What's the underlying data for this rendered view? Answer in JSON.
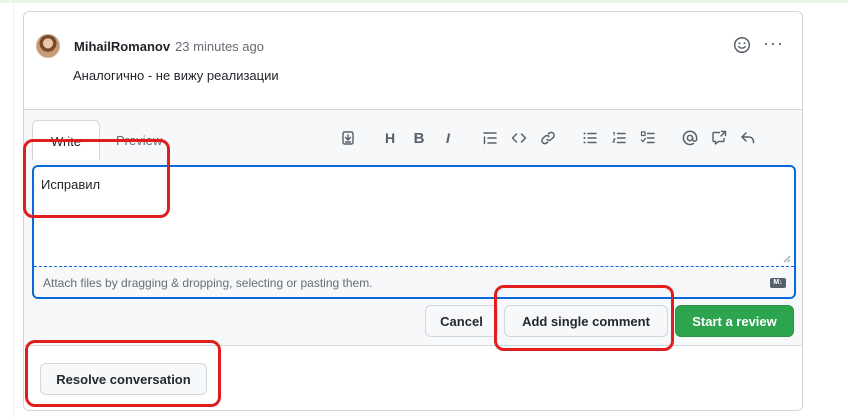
{
  "comment": {
    "author": "MihailRomanov",
    "time": "23 minutes ago",
    "body": "Аналогично - не вижу реализации",
    "avatar_icon": "user-avatar",
    "emoji_icon": "smiley-icon",
    "more_icon": "kebab-horizontal-icon",
    "more_label": "···"
  },
  "reply": {
    "tabs": [
      {
        "label": "Write",
        "active": true
      },
      {
        "label": "Preview",
        "active": false
      }
    ],
    "toolbar": {
      "heading_label": "H",
      "bold_label": "B",
      "italic_label": "I",
      "icons": [
        "insert-template-icon",
        "heading-icon",
        "bold-icon",
        "italic-icon",
        "quote-icon",
        "code-icon",
        "link-icon",
        "unordered-list-icon",
        "ordered-list-icon",
        "task-list-icon",
        "mention-icon",
        "cross-reference-icon",
        "reply-icon"
      ]
    },
    "editor_value": "Исправил",
    "attach_text": "Attach files by dragging & dropping, selecting or pasting them.",
    "markdown_badge": "M↓"
  },
  "actions": {
    "cancel_label": "Cancel",
    "single_comment_label": "Add single comment",
    "start_review_label": "Start a review",
    "resolve_label": "Resolve conversation"
  },
  "colors": {
    "focus_blue": "#0969da",
    "primary_green": "#2da44e",
    "annotation_red": "#e01e1e"
  }
}
